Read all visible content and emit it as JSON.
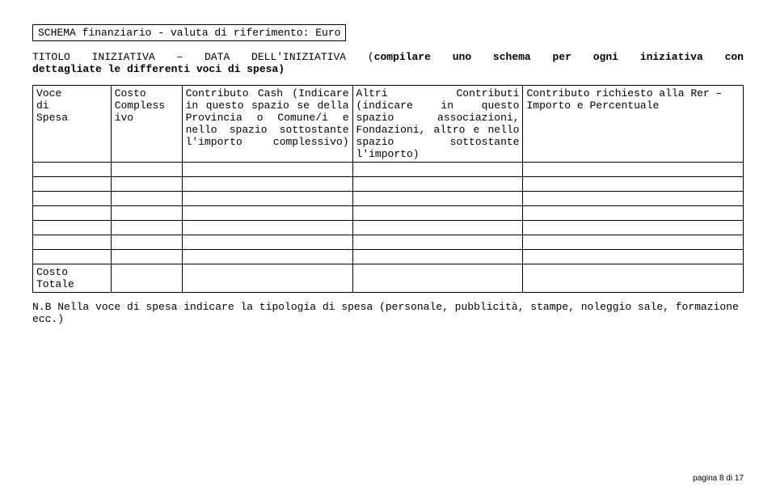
{
  "header": "SCHEMA finanziario - valuta di riferimento: Euro",
  "intro_prefix": "TITOLO INIZIATIVA – DATA DELL'INIZIATIVA",
  "intro_parenthesis_start": "(",
  "intro_bold1": "compilare uno schema per ogni iniziativa con",
  "intro_bold2": "dettagliate le differenti voci di spesa)",
  "table_headers": {
    "col1_l1": "Voce",
    "col1_l2": "di",
    "col1_l3": "Spesa",
    "col2_l1": "Costo",
    "col2_l2": "Compless",
    "col2_l3": "ivo",
    "col3": "Contributo Cash (Indicare in questo spazio se della Provincia o Comune/i e nello spazio sottostante l'importo complessivo)",
    "col4": "Altri Contributi (indicare in questo spazio associazioni, Fondazioni, altro e nello spazio sottostante l'importo)",
    "col5": "Contributo richiesto alla Rer – Importo e Percentuale"
  },
  "total_label": "Costo Totale",
  "note": "N.B Nella voce di spesa indicare la tipologia di spesa (personale, pubblicità, stampe, noleggio sale, formazione ecc.)",
  "footer": "pagina 8 di 17"
}
